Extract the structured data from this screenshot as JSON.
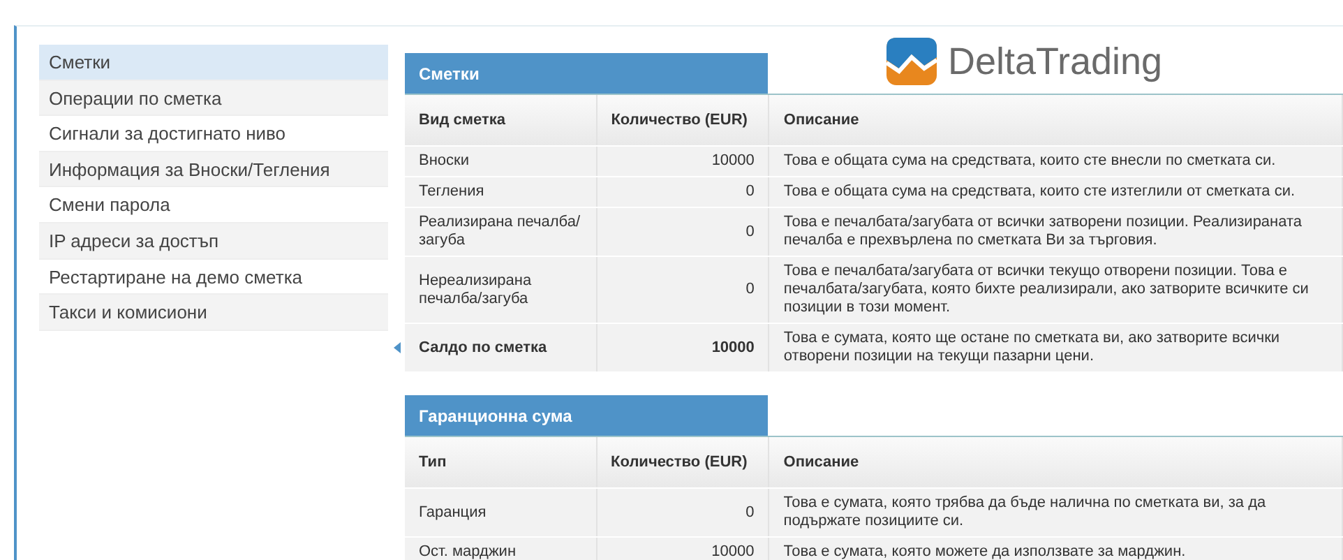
{
  "sidebar": {
    "items": [
      {
        "label": "Сметки",
        "selected": true
      },
      {
        "label": "Операции по сметка",
        "selected": false
      },
      {
        "label": "Сигнали за достигнато ниво",
        "selected": false
      },
      {
        "label": "Информация за Вноски/Тегления",
        "selected": false
      },
      {
        "label": "Смени парола",
        "selected": false
      },
      {
        "label": "IP адреси за достъп",
        "selected": false
      },
      {
        "label": "Рестартиране на демо сметка",
        "selected": false
      },
      {
        "label": "Такси и комисиони",
        "selected": false
      }
    ]
  },
  "logo": {
    "text": "DeltaTrading"
  },
  "sections": [
    {
      "title": "Сметки",
      "columns": [
        "Вид сметка",
        "Количество (EUR)",
        "Описание"
      ],
      "rows": [
        {
          "kind": "normal",
          "cells": [
            "Вноски",
            "10000",
            "Това е общата сума на средствата, които сте внесли по сметката си."
          ]
        },
        {
          "kind": "normal",
          "cells": [
            "Тегления",
            "0",
            "Това е общата сума на средствата, които сте изтеглили от сметката си."
          ]
        },
        {
          "kind": "normal",
          "cells": [
            "Реализирана печалба/ загуба",
            "0",
            "Това е печалбата/загубата от всички затворени позиции. Реализираната печалба е прехвърлена по сметката Ви за търговия."
          ]
        },
        {
          "kind": "normal",
          "cells": [
            "Нереализирана печалба/загуба",
            "0",
            "Това е печалбата/загубата от всички текущо отворени позиции. Това е печалбата/загубата, която бихте реализирали, ако затворите всичките си позиции в този момент."
          ]
        },
        {
          "kind": "total",
          "cells": [
            "Салдо по сметка",
            "10000",
            "Това е сумата, която ще остане по сметката ви, ако затворите всички отворени позиции на текущи пазарни цени."
          ]
        }
      ]
    },
    {
      "title": "Гаранционна сума",
      "columns": [
        "Тип",
        "Количество (EUR)",
        "Описание"
      ],
      "rows": [
        {
          "kind": "normal",
          "cells": [
            "Гаранция",
            "0",
            "Това е сумата, която трябва да бъде налична по сметката ви, за да подържате позициите си."
          ]
        },
        {
          "kind": "normal",
          "cells": [
            "Ост. марджин",
            "10000",
            "Това е сумата, която можете да използвате за марджин."
          ]
        }
      ]
    }
  ]
}
